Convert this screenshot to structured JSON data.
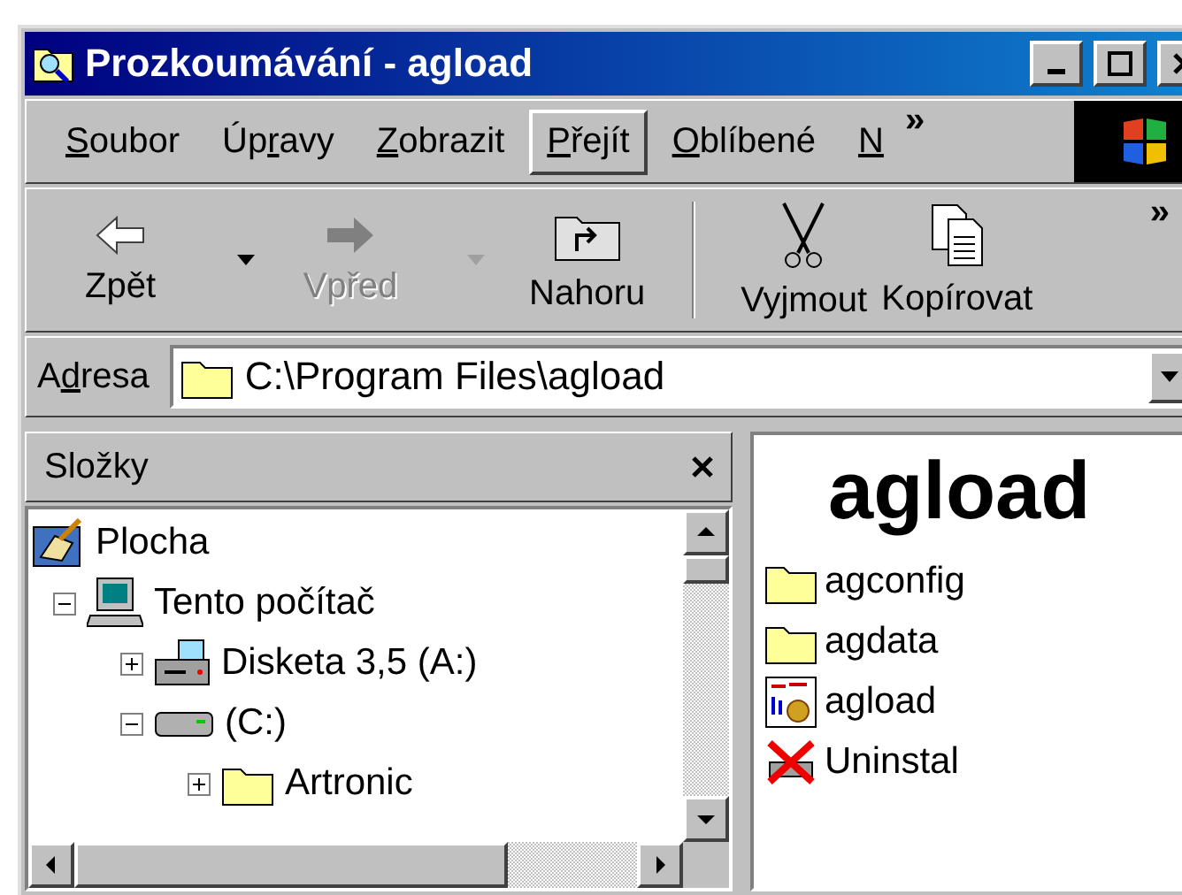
{
  "window": {
    "title": "Prozkoumávání - agload"
  },
  "menu": [
    {
      "access_key": "S",
      "text_after": "oubor",
      "selected": false
    },
    {
      "text_before": "Úp",
      "access_key": "r",
      "text_after": "avy",
      "selected": false
    },
    {
      "access_key": "Z",
      "text_after": "obrazit",
      "selected": false
    },
    {
      "access_key": "P",
      "text_after": "řejít",
      "selected": true
    },
    {
      "access_key": "O",
      "text_after": "blíbené",
      "selected": false
    },
    {
      "access_key": "N",
      "selected": false
    }
  ],
  "menu_more": "»",
  "toolbar": [
    {
      "label": "Zpět",
      "disabled": false,
      "dropdown": true
    },
    {
      "label": "Vpřed",
      "disabled": true,
      "dropdown": true
    },
    {
      "label": "Nahoru",
      "disabled": false,
      "dropdown": false
    },
    {
      "label": "Vyjmout",
      "disabled": false,
      "dropdown": false
    },
    {
      "label": "Kopírovat",
      "disabled": false,
      "dropdown": false
    }
  ],
  "toolbar_more": "»",
  "address": {
    "label": {
      "text_before": "A",
      "access_key": "d",
      "text_after": "resa"
    },
    "value": "C:\\Program Files\\agload"
  },
  "folders_pane": {
    "title": "Složky",
    "tree": [
      {
        "label": "Plocha",
        "kind": "desktop",
        "children": [
          {
            "label": "Tento počítač",
            "kind": "computer",
            "expanded": true,
            "children": [
              {
                "label": "Disketa 3,5 (A:)",
                "kind": "floppy",
                "expanded": false
              },
              {
                "label": "(C:)",
                "kind": "harddrive",
                "expanded": true,
                "children": [
                  {
                    "label": "Artronic",
                    "kind": "folder",
                    "expanded": false
                  }
                ]
              }
            ]
          }
        ]
      }
    ]
  },
  "content": {
    "heading": "agload",
    "items": [
      {
        "label": "agconfig",
        "kind": "folder"
      },
      {
        "label": "agdata",
        "kind": "folder"
      },
      {
        "label": "agload",
        "kind": "program"
      },
      {
        "label": "Uninstal",
        "kind": "uninstall"
      }
    ]
  }
}
